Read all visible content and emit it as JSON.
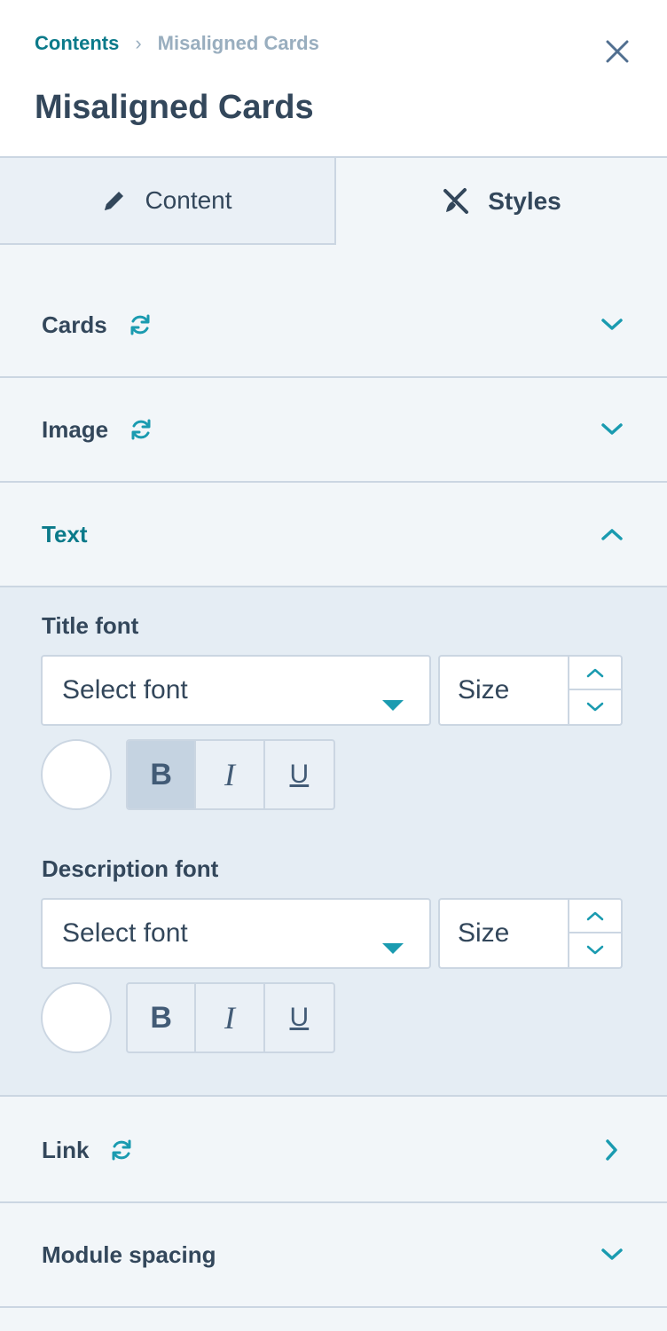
{
  "header": {
    "breadcrumb_link": "Contents",
    "breadcrumb_separator": "›",
    "breadcrumb_current": "Misaligned Cards",
    "title": "Misaligned Cards"
  },
  "tabs": [
    {
      "label": "Content",
      "icon": "pencil-icon",
      "active": false
    },
    {
      "label": "Styles",
      "icon": "paint-brush-ruler-icon",
      "active": true
    }
  ],
  "sections": {
    "cards": {
      "label": "Cards",
      "synced": true,
      "state": "collapsed"
    },
    "image": {
      "label": "Image",
      "synced": true,
      "state": "collapsed"
    },
    "text": {
      "label": "Text",
      "synced": false,
      "state": "expanded"
    },
    "link": {
      "label": "Link",
      "synced": true,
      "state": "collapsed-right"
    },
    "module_spacing": {
      "label": "Module spacing",
      "synced": false,
      "state": "collapsed"
    }
  },
  "text_panel": {
    "title_font": {
      "label": "Title font",
      "font_placeholder": "Select font",
      "size_placeholder": "Size",
      "bold": "B",
      "italic": "I",
      "underline": "U",
      "bold_active": true
    },
    "description_font": {
      "label": "Description font",
      "font_placeholder": "Select font",
      "size_placeholder": "Size",
      "bold": "B",
      "italic": "I",
      "underline": "U",
      "bold_active": false
    }
  },
  "colors": {
    "accent": "#0b7a8a",
    "sync_icon": "#1a9bb0",
    "text": "#33475b",
    "border": "#cbd6e2"
  }
}
